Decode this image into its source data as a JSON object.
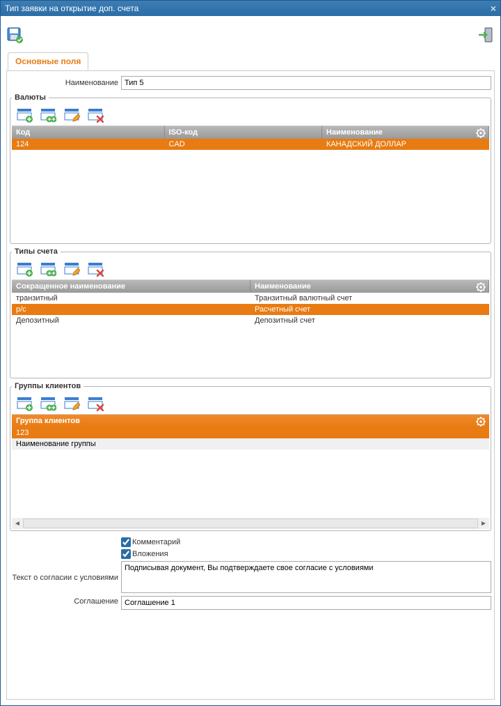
{
  "window": {
    "title": "Тип заявки на открытие доп. счета",
    "tabs": {
      "main": "Основные поля"
    }
  },
  "form": {
    "name_label": "Наименование",
    "name_value": "Тип 5",
    "comment_label": "Комментарий",
    "attachments_label": "Вложения",
    "consent_label": "Текст о согласии с условиями",
    "consent_value": "Подписывая документ, Вы подтверждаете свое согласие с условиями",
    "agreement_label": "Соглашение",
    "agreement_value": "Соглашение 1"
  },
  "currencies": {
    "legend": "Валюты",
    "columns": {
      "code": "Код",
      "iso": "ISO-код",
      "name": "Наименование"
    },
    "rows": [
      {
        "code": "124",
        "iso": "CAD",
        "name": "КАНАДСКИЙ ДОЛЛАР",
        "selected": true
      }
    ]
  },
  "accountTypes": {
    "legend": "Типы счета",
    "columns": {
      "short": "Сокращенное наименование",
      "name": "Наименование"
    },
    "rows": [
      {
        "short": "транзитный",
        "name": "Транзитный валютный счет",
        "selected": false
      },
      {
        "short": "р/с",
        "name": "Расчетный счет",
        "selected": true
      },
      {
        "short": "Депозитный",
        "name": "Депозитный счет",
        "selected": false
      }
    ]
  },
  "clientGroups": {
    "legend": "Группы клиентов",
    "columns": {
      "group": "Группа клиентов"
    },
    "rows": [
      {
        "group": "123",
        "selected": true
      },
      {
        "group": "Наименование группы",
        "selected": false
      }
    ]
  }
}
